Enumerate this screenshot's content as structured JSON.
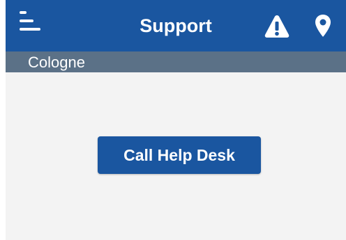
{
  "header": {
    "title": "Support",
    "menu_icon": "menu-icon",
    "alert_icon": "warning-icon",
    "location_icon": "map-pin-icon"
  },
  "subheader": {
    "location": "Cologne"
  },
  "main": {
    "call_button_label": "Call Help Desk"
  },
  "colors": {
    "primary": "#1a56a0",
    "subheader": "#5b7187",
    "background": "#f3f3f3",
    "text_on_primary": "#ffffff"
  }
}
